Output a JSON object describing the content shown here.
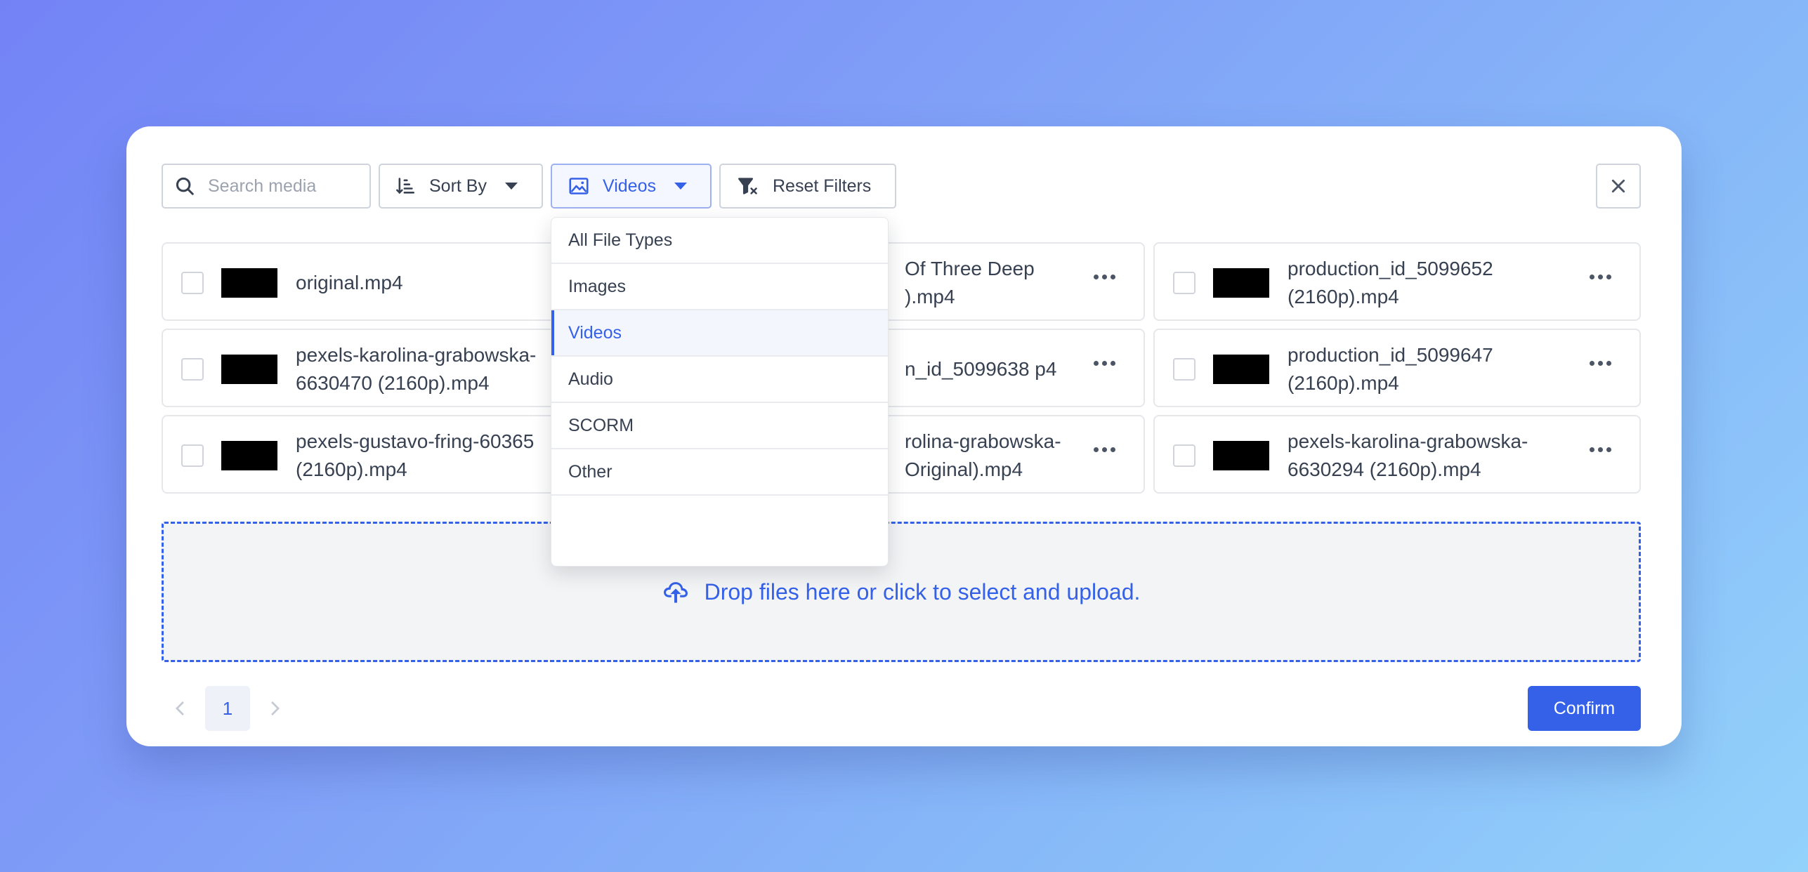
{
  "toolbar": {
    "search_placeholder": "Search media",
    "sort_label": "Sort By",
    "filter_label": "Videos",
    "reset_label": "Reset Filters"
  },
  "files": [
    {
      "name": "original.mp4"
    },
    {
      "name": "Of Three Deep ).mp4"
    },
    {
      "name": "production_id_5099652 (2160p).mp4"
    },
    {
      "name": "pexels-karolina-grabowska-6630470 (2160p).mp4"
    },
    {
      "name": "n_id_5099638 p4"
    },
    {
      "name": "production_id_5099647 (2160p).mp4"
    },
    {
      "name": "pexels-gustavo-fring-60365 (2160p).mp4"
    },
    {
      "name": "rolina-grabowska- Original).mp4"
    },
    {
      "name": "pexels-karolina-grabowska-6630294 (2160p).mp4"
    }
  ],
  "dropzone": {
    "text": "Drop files here or click to select and upload."
  },
  "pagination": {
    "current_page": "1"
  },
  "confirm_label": "Confirm",
  "dropdown": {
    "items": [
      {
        "label": "All File Types",
        "active": false
      },
      {
        "label": "Images",
        "active": false
      },
      {
        "label": "Videos",
        "active": true
      },
      {
        "label": "Audio",
        "active": false
      },
      {
        "label": "SCORM",
        "active": false
      },
      {
        "label": "Other",
        "active": false
      }
    ]
  },
  "colors": {
    "accent": "#3461e8",
    "border": "#cfd4dc",
    "text": "#374151"
  }
}
